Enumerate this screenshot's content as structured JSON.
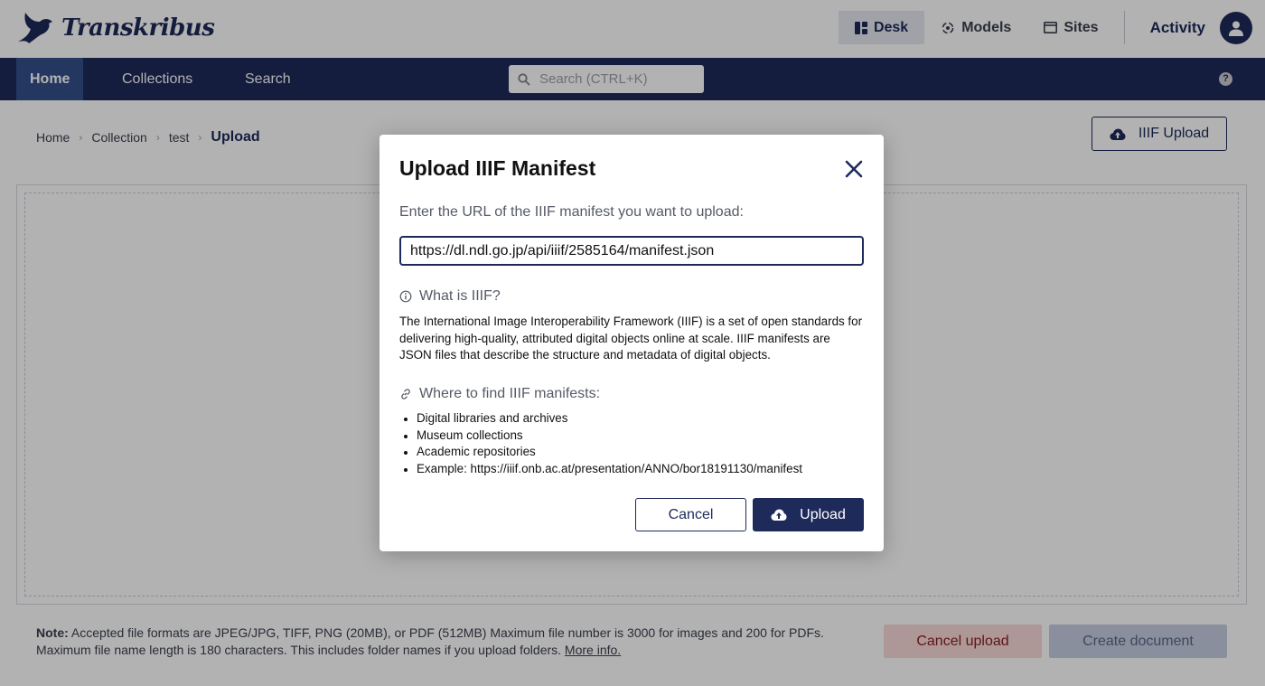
{
  "app": {
    "brand": "Transkribus",
    "top_nav": {
      "desk": "Desk",
      "models": "Models",
      "sites": "Sites",
      "activity": "Activity"
    },
    "main_nav": {
      "home": "Home",
      "collections": "Collections",
      "search": "Search"
    },
    "search": {
      "placeholder": "Search (CTRL+K)"
    }
  },
  "page": {
    "breadcrumb": [
      "Home",
      "Collection",
      "test",
      "Upload"
    ],
    "iiif_upload_label": "IIIF Upload",
    "note_label": "Note:",
    "note_text": "Accepted file formats are JPEG/JPG, TIFF, PNG (20MB), or PDF (512MB) Maximum file number is 3000 for images and 200 for PDFs. Maximum file name length is 180 characters. This includes folder names if you upload folders.",
    "more_info": "More info.",
    "cancel_upload": "Cancel upload",
    "create_document": "Create document"
  },
  "modal": {
    "title": "Upload IIIF Manifest",
    "prompt": "Enter the URL of the IIIF manifest you want to upload:",
    "url_value": "https://dl.ndl.go.jp/api/iiif/2585164/manifest.json",
    "what_heading": "What is IIIF?",
    "what_text": "The International Image Interoperability Framework (IIIF) is a set of open standards for delivering high-quality, attributed digital objects online at scale. IIIF manifests are JSON files that describe the structure and metadata of digital objects.",
    "where_heading": "Where to find IIIF manifests:",
    "where_items": [
      "Digital libraries and archives",
      "Museum collections",
      "Academic repositories",
      "Example: https://iiif.onb.ac.at/presentation/ANNO/bor18191130/manifest"
    ],
    "cancel": "Cancel",
    "upload": "Upload"
  },
  "colors": {
    "brand_navy": "#1e2a5a",
    "nav_active": "#34508c",
    "cancel_upload_bg": "#f9d9d9",
    "create_doc_bg": "#c4cde0"
  },
  "icons": [
    "logo-bird-icon",
    "desk-icon",
    "models-icon",
    "sites-icon",
    "user-avatar-icon",
    "search-icon",
    "help-icon",
    "cloud-upload-icon",
    "close-icon",
    "info-icon",
    "link-icon"
  ]
}
